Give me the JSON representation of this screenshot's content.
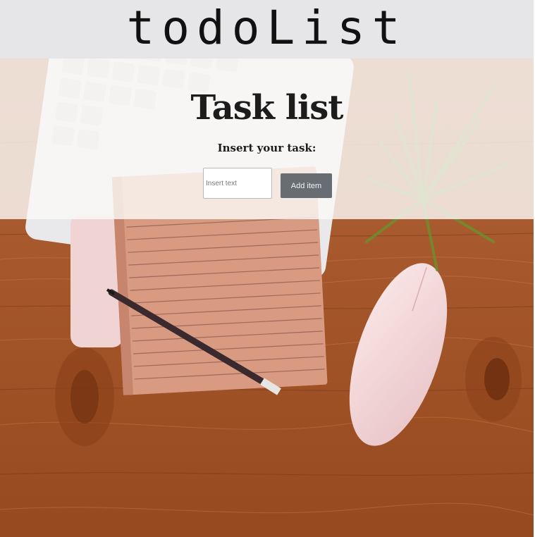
{
  "banner": {
    "title": "todoList"
  },
  "header": {
    "heading": "Task list",
    "subheading": "Insert your task:"
  },
  "form": {
    "input_placeholder": "Insert text",
    "input_value": "",
    "add_button_label": "Add item"
  },
  "colors": {
    "banner_bg": "#e6e6e8",
    "button_bg": "#676d72",
    "wood": "#a85a2c"
  }
}
